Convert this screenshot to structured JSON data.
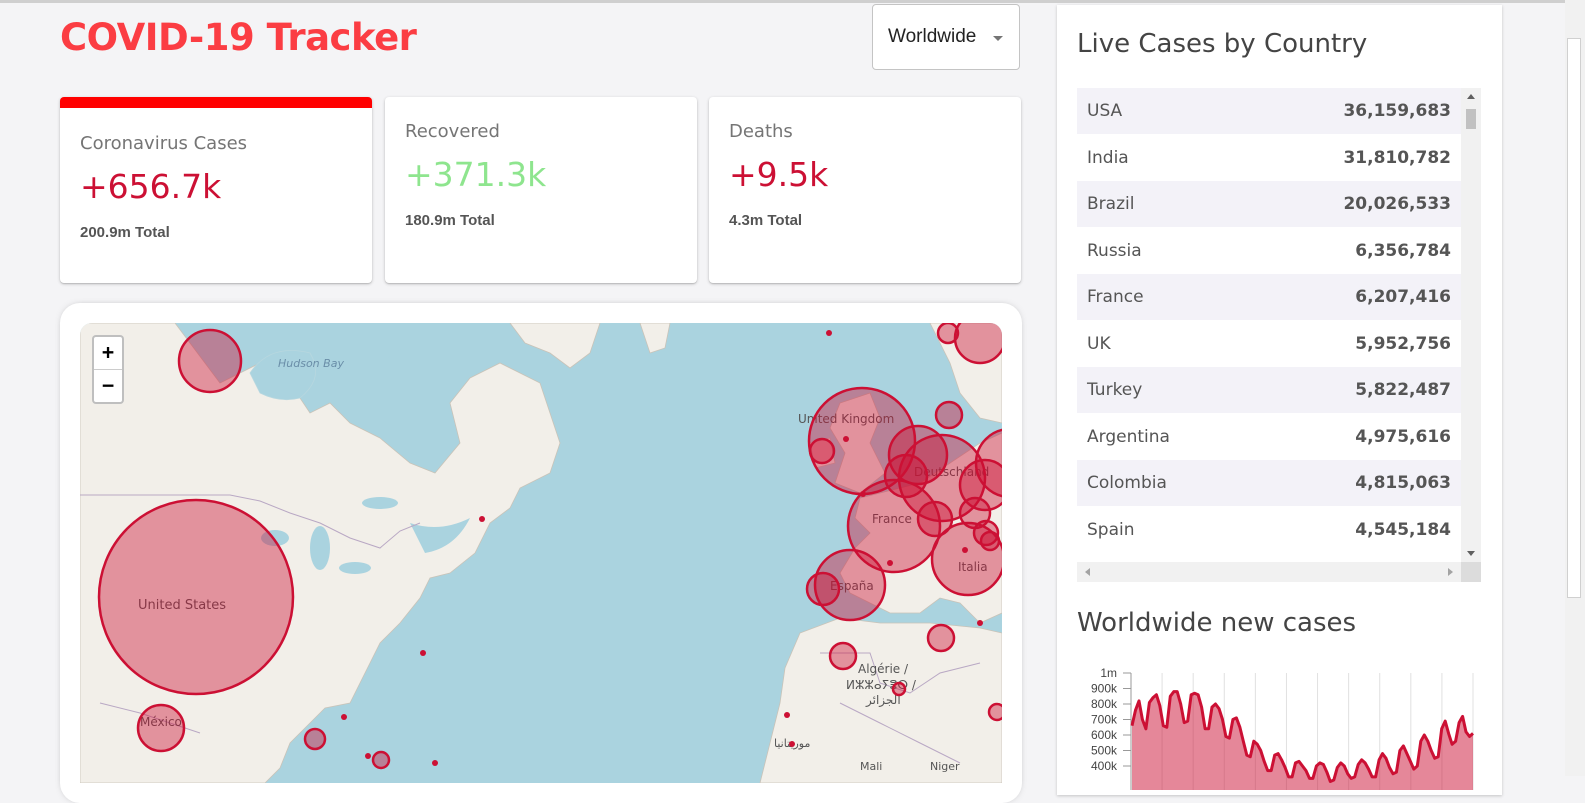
{
  "app": {
    "title": "COVID-19 Tracker"
  },
  "country_select": {
    "value": "Worldwide"
  },
  "info_boxes": [
    {
      "title": "Coronavirus Cases",
      "cases": "+656.7k",
      "total": "200.9m Total",
      "color": "#cc1034",
      "selected": true
    },
    {
      "title": "Recovered",
      "cases": "+371.3k",
      "total": "180.9m Total",
      "color": "#8ee58e",
      "selected": false
    },
    {
      "title": "Deaths",
      "cases": "+9.5k",
      "total": "4.3m Total",
      "color": "#cc1034",
      "selected": false
    }
  ],
  "map": {
    "zoom_in": "+",
    "zoom_out": "−",
    "labels": {
      "hudson_bay": "Hudson Bay",
      "united_states": "United States",
      "mexico": "México",
      "united_kingdom": "United Kingdom",
      "france": "France",
      "deutschland": "Deutschland",
      "espana": "España",
      "italia": "Italia",
      "algerie": "Algérie /",
      "algerie_tifinagh": "ⵍⵣⵣⴰⵢⴻⵔ /",
      "algerie_arabic": "الجزائر",
      "mauritania": "موريتانيا",
      "mali": "Mali",
      "niger": "Niger"
    },
    "circle_color": "#cc1034"
  },
  "sidebar": {
    "table_title": "Live Cases by Country",
    "chart_title": "Worldwide new cases",
    "countries": [
      {
        "country": "USA",
        "cases": "36,159,683"
      },
      {
        "country": "India",
        "cases": "31,810,782"
      },
      {
        "country": "Brazil",
        "cases": "20,026,533"
      },
      {
        "country": "Russia",
        "cases": "6,356,784"
      },
      {
        "country": "France",
        "cases": "6,207,416"
      },
      {
        "country": "UK",
        "cases": "5,952,756"
      },
      {
        "country": "Turkey",
        "cases": "5,822,487"
      },
      {
        "country": "Argentina",
        "cases": "4,975,616"
      },
      {
        "country": "Colombia",
        "cases": "4,815,063"
      },
      {
        "country": "Spain",
        "cases": "4,545,184"
      }
    ]
  },
  "chart_data": {
    "type": "area",
    "title": "",
    "xlabel": "",
    "ylabel": "",
    "ylim": [
      300000,
      1000000
    ],
    "y_ticks": [
      "1m",
      "900k",
      "800k",
      "700k",
      "600k",
      "500k",
      "400k"
    ],
    "y_tick_values": [
      1000000,
      900000,
      800000,
      700000,
      600000,
      500000,
      400000
    ],
    "color": "#cc1034",
    "fill": "rgba(204,16,52,0.5)",
    "values": [
      660000,
      760000,
      820000,
      700000,
      640000,
      810000,
      840000,
      860000,
      790000,
      660000,
      650000,
      850000,
      880000,
      880000,
      800000,
      680000,
      690000,
      860000,
      870000,
      860000,
      780000,
      640000,
      640000,
      780000,
      800000,
      770000,
      700000,
      590000,
      580000,
      700000,
      710000,
      650000,
      560000,
      470000,
      460000,
      560000,
      540000,
      500000,
      430000,
      370000,
      370000,
      470000,
      480000,
      440000,
      390000,
      330000,
      330000,
      420000,
      430000,
      400000,
      370000,
      320000,
      320000,
      400000,
      420000,
      410000,
      360000,
      300000,
      310000,
      390000,
      420000,
      400000,
      350000,
      320000,
      330000,
      410000,
      440000,
      420000,
      380000,
      330000,
      330000,
      440000,
      480000,
      450000,
      390000,
      350000,
      360000,
      500000,
      530000,
      480000,
      430000,
      380000,
      400000,
      560000,
      600000,
      560000,
      500000,
      450000,
      460000,
      640000,
      690000,
      610000,
      540000,
      560000,
      680000,
      720000,
      620000,
      590000,
      610000
    ]
  }
}
